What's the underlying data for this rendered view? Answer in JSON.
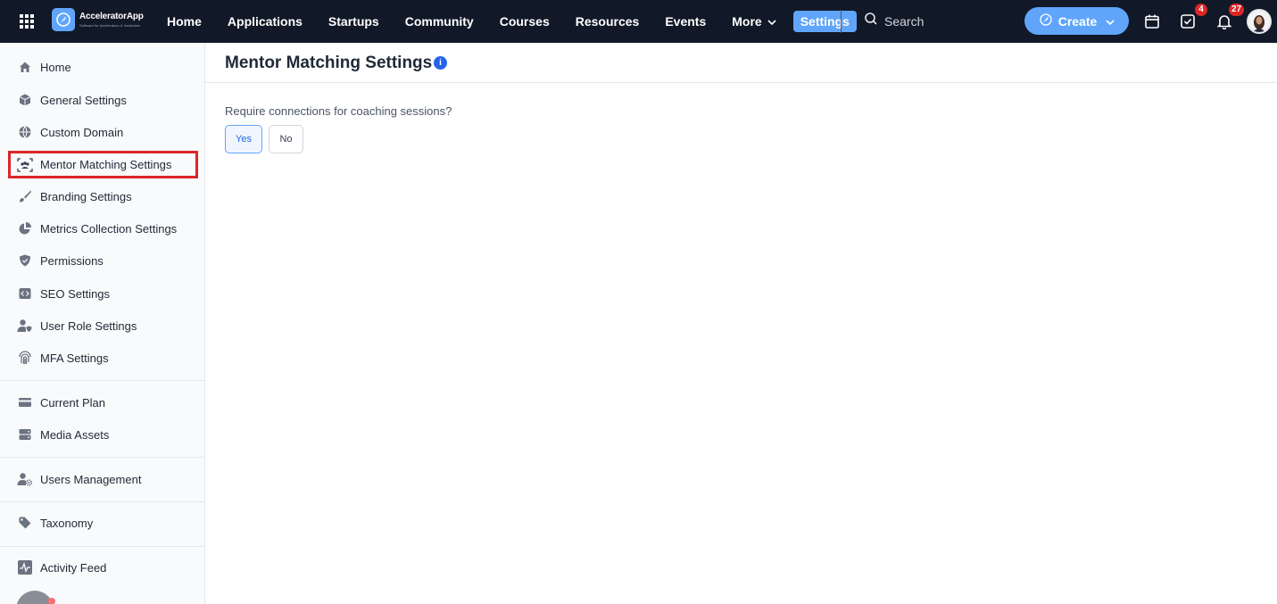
{
  "app": {
    "logo_name": "AcceleratorApp",
    "logo_tagline": "Software for Accelerators & Incubators"
  },
  "nav": {
    "items": [
      {
        "label": "Home"
      },
      {
        "label": "Applications"
      },
      {
        "label": "Startups"
      },
      {
        "label": "Community"
      },
      {
        "label": "Courses"
      },
      {
        "label": "Resources"
      },
      {
        "label": "Events"
      },
      {
        "label": "More"
      },
      {
        "label": "Settings",
        "active": true
      }
    ]
  },
  "search": {
    "placeholder": "Search"
  },
  "create": {
    "label": "Create"
  },
  "topbar_icons": {
    "calendar": "calendar-icon",
    "tasks": "task-check-icon",
    "tasks_badge": "4",
    "notifications": "bell-icon",
    "notifications_badge": "27"
  },
  "sidebar": {
    "items": [
      {
        "label": "Home",
        "icon": "home-icon"
      },
      {
        "label": "General Settings",
        "icon": "box-icon"
      },
      {
        "label": "Custom Domain",
        "icon": "globe-icon"
      },
      {
        "label": "Mentor Matching Settings",
        "icon": "users-scan-icon",
        "selected": true
      },
      {
        "label": "Branding Settings",
        "icon": "brush-icon"
      },
      {
        "label": "Metrics Collection Settings",
        "icon": "pie-chart-icon"
      },
      {
        "label": "Permissions",
        "icon": "shield-icon"
      },
      {
        "label": "SEO Settings",
        "icon": "code-icon"
      },
      {
        "label": "User Role Settings",
        "icon": "user-shield-icon"
      },
      {
        "label": "MFA Settings",
        "icon": "fingerprint-icon"
      },
      {
        "label": "Current Plan",
        "icon": "card-icon"
      },
      {
        "label": "Media Assets",
        "icon": "server-icon"
      },
      {
        "label": "Users Management",
        "icon": "user-gear-icon"
      },
      {
        "label": "Taxonomy",
        "icon": "tag-icon"
      },
      {
        "label": "Activity Feed",
        "icon": "activity-icon"
      }
    ]
  },
  "page": {
    "title": "Mentor Matching Settings",
    "info_icon_glyph": "i",
    "question": "Require connections for coaching sessions?",
    "options": [
      {
        "label": "Yes",
        "selected": true
      },
      {
        "label": "No",
        "selected": false
      }
    ]
  },
  "colors": {
    "topbar": "#111827",
    "accent": "#60a5fa",
    "highlight_box": "#dc2626",
    "badge": "#dc2626"
  }
}
